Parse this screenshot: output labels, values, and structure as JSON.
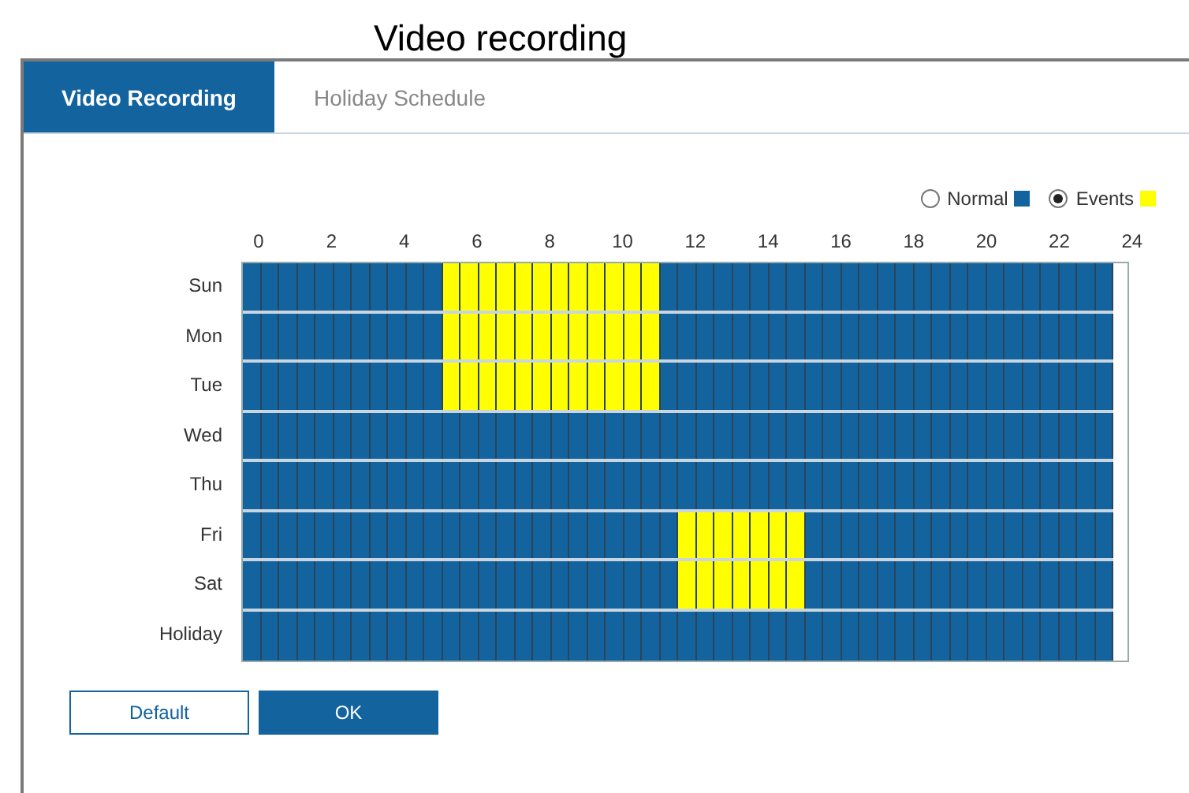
{
  "page_title": "Video recording",
  "tabs": [
    {
      "label": "Video Recording",
      "selected": true
    },
    {
      "label": "Holiday Schedule",
      "selected": false
    }
  ],
  "modes": [
    {
      "label": "Normal",
      "selected": false,
      "color": "#13639f"
    },
    {
      "label": "Events",
      "selected": true,
      "color": "#ffff00"
    }
  ],
  "hours": [
    "0",
    "2",
    "4",
    "6",
    "8",
    "10",
    "12",
    "14",
    "16",
    "18",
    "20",
    "22",
    "24"
  ],
  "rows": [
    {
      "day": "Sun",
      "events": [
        false,
        false,
        false,
        false,
        false,
        false,
        false,
        false,
        false,
        false,
        false,
        true,
        true,
        true,
        true,
        true,
        true,
        true,
        true,
        true,
        true,
        true,
        true,
        false,
        false,
        false,
        false,
        false,
        false,
        false,
        false,
        false,
        false,
        false,
        false,
        false,
        false,
        false,
        false,
        false,
        false,
        false,
        false,
        false,
        false,
        false,
        false,
        false
      ]
    },
    {
      "day": "Mon",
      "events": [
        false,
        false,
        false,
        false,
        false,
        false,
        false,
        false,
        false,
        false,
        false,
        true,
        true,
        true,
        true,
        true,
        true,
        true,
        true,
        true,
        true,
        true,
        true,
        false,
        false,
        false,
        false,
        false,
        false,
        false,
        false,
        false,
        false,
        false,
        false,
        false,
        false,
        false,
        false,
        false,
        false,
        false,
        false,
        false,
        false,
        false,
        false,
        false
      ]
    },
    {
      "day": "Tue",
      "events": [
        false,
        false,
        false,
        false,
        false,
        false,
        false,
        false,
        false,
        false,
        false,
        true,
        true,
        true,
        true,
        true,
        true,
        true,
        true,
        true,
        true,
        true,
        true,
        false,
        false,
        false,
        false,
        false,
        false,
        false,
        false,
        false,
        false,
        false,
        false,
        false,
        false,
        false,
        false,
        false,
        false,
        false,
        false,
        false,
        false,
        false,
        false,
        false
      ]
    },
    {
      "day": "Wed",
      "events": [
        false,
        false,
        false,
        false,
        false,
        false,
        false,
        false,
        false,
        false,
        false,
        false,
        false,
        false,
        false,
        false,
        false,
        false,
        false,
        false,
        false,
        false,
        false,
        false,
        false,
        false,
        false,
        false,
        false,
        false,
        false,
        false,
        false,
        false,
        false,
        false,
        false,
        false,
        false,
        false,
        false,
        false,
        false,
        false,
        false,
        false,
        false,
        false
      ]
    },
    {
      "day": "Thu",
      "events": [
        false,
        false,
        false,
        false,
        false,
        false,
        false,
        false,
        false,
        false,
        false,
        false,
        false,
        false,
        false,
        false,
        false,
        false,
        false,
        false,
        false,
        false,
        false,
        false,
        false,
        false,
        false,
        false,
        false,
        false,
        false,
        false,
        false,
        false,
        false,
        false,
        false,
        false,
        false,
        false,
        false,
        false,
        false,
        false,
        false,
        false,
        false,
        false
      ]
    },
    {
      "day": "Fri",
      "events": [
        false,
        false,
        false,
        false,
        false,
        false,
        false,
        false,
        false,
        false,
        false,
        false,
        false,
        false,
        false,
        false,
        false,
        false,
        false,
        false,
        false,
        false,
        false,
        false,
        true,
        true,
        true,
        true,
        true,
        true,
        true,
        false,
        false,
        false,
        false,
        false,
        false,
        false,
        false,
        false,
        false,
        false,
        false,
        false,
        false,
        false,
        false,
        false
      ]
    },
    {
      "day": "Sat",
      "events": [
        false,
        false,
        false,
        false,
        false,
        false,
        false,
        false,
        false,
        false,
        false,
        false,
        false,
        false,
        false,
        false,
        false,
        false,
        false,
        false,
        false,
        false,
        false,
        false,
        true,
        true,
        true,
        true,
        true,
        true,
        true,
        false,
        false,
        false,
        false,
        false,
        false,
        false,
        false,
        false,
        false,
        false,
        false,
        false,
        false,
        false,
        false,
        false
      ]
    },
    {
      "day": "Holiday",
      "events": [
        false,
        false,
        false,
        false,
        false,
        false,
        false,
        false,
        false,
        false,
        false,
        false,
        false,
        false,
        false,
        false,
        false,
        false,
        false,
        false,
        false,
        false,
        false,
        false,
        false,
        false,
        false,
        false,
        false,
        false,
        false,
        false,
        false,
        false,
        false,
        false,
        false,
        false,
        false,
        false,
        false,
        false,
        false,
        false,
        false,
        false,
        false,
        false
      ]
    }
  ],
  "buttons": [
    {
      "label": "Default",
      "kind": "secondary"
    },
    {
      "label": "OK",
      "kind": "primary"
    }
  ]
}
